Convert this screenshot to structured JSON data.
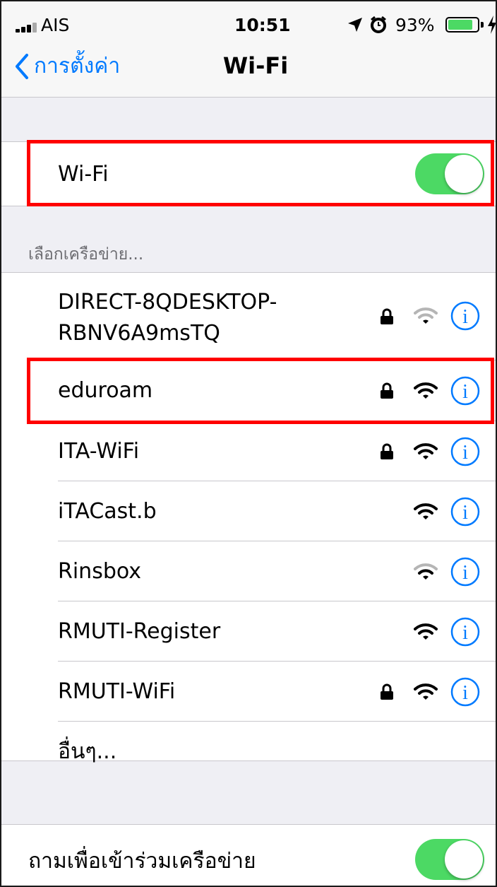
{
  "status_bar": {
    "carrier": "AIS",
    "time": "10:51",
    "battery_percent": "93%",
    "battery_level": 0.93,
    "icons": [
      "signal-icon",
      "location-icon",
      "alarm-icon",
      "battery-icon",
      "charging-icon"
    ]
  },
  "nav": {
    "back_label": "การตั้งค่า",
    "title": "Wi-Fi"
  },
  "wifi_toggle": {
    "label": "Wi-Fi",
    "on": true
  },
  "networks_header": "เลือกเครือข่าย...",
  "networks": [
    {
      "name_line1": "DIRECT-8QDESKTOP-",
      "name_line2": "RBNV6A9msTQ",
      "locked": true,
      "signal": "weak"
    },
    {
      "name": "eduroam",
      "locked": true,
      "signal": "full"
    },
    {
      "name": "ITA-WiFi",
      "locked": true,
      "signal": "full"
    },
    {
      "name": "iTACast.b",
      "locked": false,
      "signal": "full"
    },
    {
      "name": "Rinsbox",
      "locked": false,
      "signal": "weak"
    },
    {
      "name": "RMUTI-Register",
      "locked": false,
      "signal": "full"
    },
    {
      "name": "RMUTI-WiFi",
      "locked": true,
      "signal": "full"
    }
  ],
  "other_label": "อื่นๆ...",
  "ask_to_join": {
    "label": "ถามเพื่อเข้าร่วมเครือข่าย",
    "on": true
  },
  "colors": {
    "accent": "#007aff",
    "toggle_on": "#4cd964",
    "highlight": "#ff0000",
    "background": "#efeff4"
  }
}
